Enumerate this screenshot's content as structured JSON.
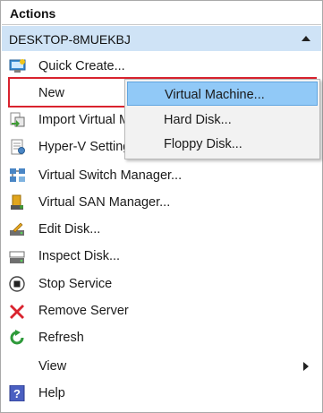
{
  "pane": {
    "title": "Actions",
    "section_label": "DESKTOP-8MUEKBJ"
  },
  "items": [
    {
      "label": "Quick Create...",
      "icon": "quick-create-icon"
    },
    {
      "label": "New",
      "icon": ""
    },
    {
      "label": "Import Virtual M",
      "icon": "import-vm-icon"
    },
    {
      "label": "Hyper-V Settings",
      "icon": "settings-icon"
    },
    {
      "label": "Virtual Switch Manager...",
      "icon": "switch-manager-icon"
    },
    {
      "label": "Virtual SAN Manager...",
      "icon": "san-manager-icon"
    },
    {
      "label": "Edit Disk...",
      "icon": "edit-disk-icon"
    },
    {
      "label": "Inspect Disk...",
      "icon": "inspect-disk-icon"
    },
    {
      "label": "Stop Service",
      "icon": "stop-icon"
    },
    {
      "label": "Remove Server",
      "icon": "remove-icon"
    },
    {
      "label": "Refresh",
      "icon": "refresh-icon"
    },
    {
      "label": "View",
      "icon": ""
    },
    {
      "label": "Help",
      "icon": "help-icon"
    }
  ],
  "flyout": {
    "items": [
      {
        "label": "Virtual Machine..."
      },
      {
        "label": "Hard Disk..."
      },
      {
        "label": "Floppy Disk..."
      }
    ]
  },
  "colors": {
    "section_bg": "#cfe3f6",
    "selection_bg": "#91c9f7",
    "highlight_red": "#d9232e"
  }
}
